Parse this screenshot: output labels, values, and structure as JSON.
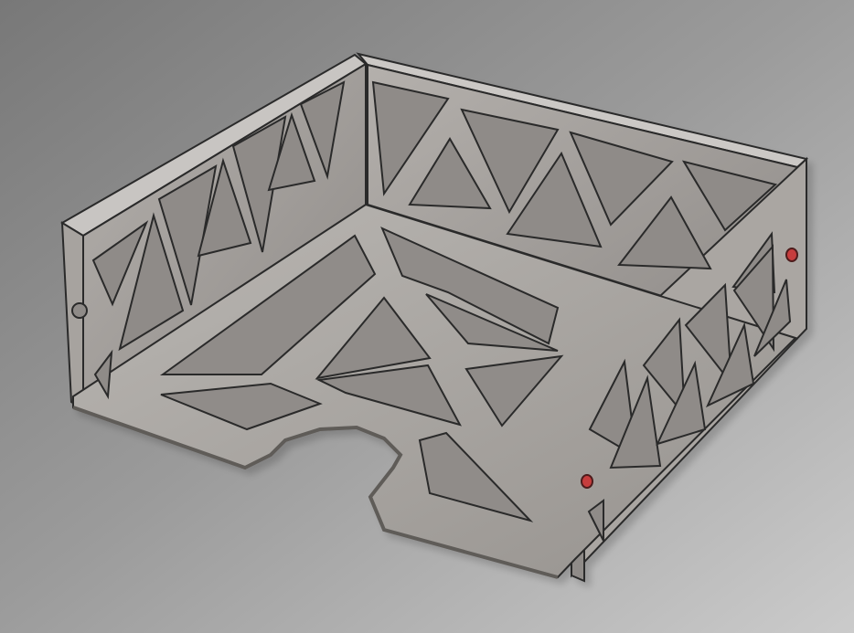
{
  "scene": {
    "subject": "sheet-metal-tray-model",
    "background_colors": [
      "#7c7c7c",
      "#a1a1a1",
      "#c7c7c7"
    ],
    "part_colors": {
      "face": "#a09c98",
      "face_dark": "#7e7a76",
      "edge": "#1f1f1f",
      "hole": "#8f8f8f",
      "accent_marker": "#cc3b3b"
    },
    "icons": [
      "tray-model-icon",
      "red-marker-icon"
    ]
  }
}
